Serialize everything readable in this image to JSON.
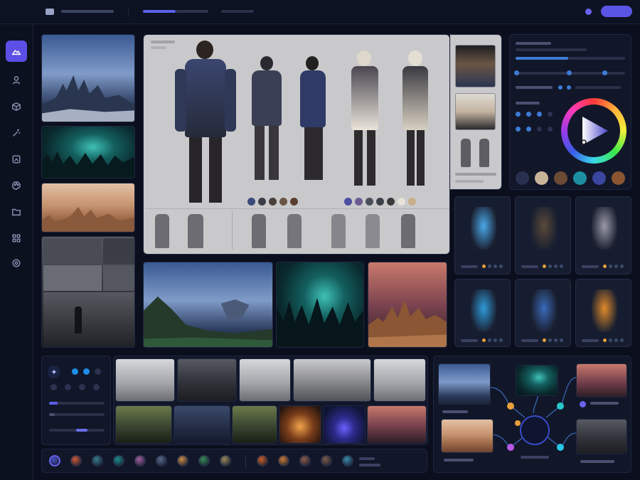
{
  "colors": {
    "accent": "#5b4fe6",
    "background": "#0b0f1d",
    "panel": "#111729",
    "sheet": "#c9c9cb"
  },
  "topbar": {
    "logo_icon": "app-logo-icon",
    "active_tab_indicator": "accent",
    "primary_button_color": "#5b4fe6"
  },
  "sidebar": {
    "items": [
      {
        "icon": "landscape-icon",
        "active": true
      },
      {
        "icon": "user-icon",
        "active": false
      },
      {
        "icon": "cube-icon",
        "active": false
      },
      {
        "icon": "magic-wand-icon",
        "active": false
      },
      {
        "icon": "image-frame-icon",
        "active": false
      },
      {
        "icon": "palette-icon",
        "active": false
      },
      {
        "icon": "folder-icon",
        "active": false
      },
      {
        "icon": "grid-icon",
        "active": false
      },
      {
        "icon": "settings-icon",
        "active": false
      }
    ]
  },
  "character_sheet": {
    "palette_left": [
      "#3a4a7a",
      "#3a3d48",
      "#4a3f3a",
      "#6a5444",
      "#5a3f30"
    ],
    "palette_right": [
      "#4a4fa0",
      "#6a5a90",
      "#4a4e5a",
      "#3b3f48",
      "#3a3a3a",
      "#e8e2d8",
      "#c8ae88"
    ]
  },
  "color_picker": {
    "swatches": [
      "#2a3150",
      "#c9b49a",
      "#6b4a36",
      "#1c8fa2",
      "#3a46a0",
      "#8a5530"
    ],
    "toggle_dots_row1": [
      "#3d7bd6",
      "#3d7bd6",
      "#3d7bd6",
      "#2b3350"
    ],
    "toggle_dots_row2": [
      "#3d7bd6",
      "#3d7bd6",
      "#2b3350",
      "#2b3350"
    ]
  },
  "assets": [
    {
      "icon": "crystal-icon",
      "color": "#4aa8e8"
    },
    {
      "icon": "spellbook-icon",
      "color": "#5a4a3a"
    },
    {
      "icon": "sword-icon",
      "color": "#9a9aa8"
    },
    {
      "icon": "potion-icon",
      "color": "#2f9ad8"
    },
    {
      "icon": "amulet-icon",
      "color": "#3a6ab8"
    },
    {
      "icon": "lantern-icon",
      "color": "#e08a2a"
    }
  ],
  "chips": [
    "#4a56c8",
    "#c95a3a",
    "#3a7a8a",
    "#1e8a8a",
    "#a060a0",
    "#5a6a8a",
    "#c88a4a",
    "#3a8a5a",
    "#9a8a5a",
    "#c8602a",
    "#c87a3a",
    "#8a5a4a",
    "#7a5a4a",
    "#3a8aa8"
  ]
}
